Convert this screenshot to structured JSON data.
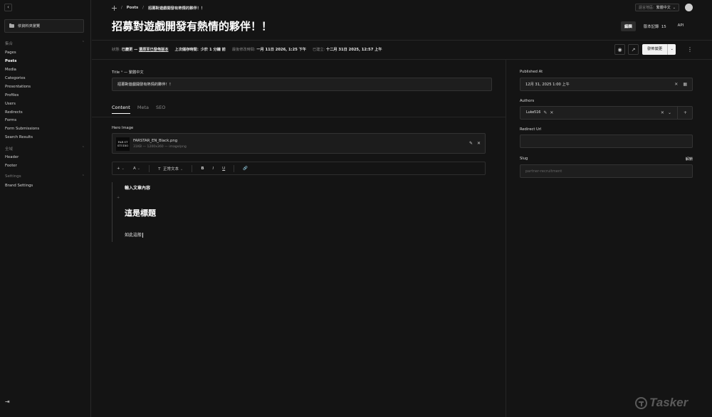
{
  "sidebar": {
    "back_icon": "‹",
    "folder_label": "依資料夾瀏覽",
    "groups": [
      {
        "label": "集合",
        "items": [
          {
            "label": "Pages",
            "active": false
          },
          {
            "label": "Posts",
            "active": true
          },
          {
            "label": "Media",
            "active": false
          },
          {
            "label": "Categories",
            "active": false
          },
          {
            "label": "Presentations",
            "active": false
          },
          {
            "label": "Profiles",
            "active": false
          },
          {
            "label": "Users",
            "active": false
          },
          {
            "label": "Redirects",
            "active": false
          },
          {
            "label": "Forms",
            "active": false
          },
          {
            "label": "Form Submissions",
            "active": false
          },
          {
            "label": "Search Results",
            "active": false
          }
        ]
      },
      {
        "label": "全域",
        "items": [
          {
            "label": "Header",
            "active": false
          },
          {
            "label": "Footer",
            "active": false
          }
        ]
      },
      {
        "label": "Settings",
        "items": [
          {
            "label": "Brand Settings",
            "active": false
          }
        ]
      }
    ],
    "logout_icon": "⇥"
  },
  "header": {
    "breadcrumb": {
      "section": "Posts",
      "current": "招募對遊戲開發有熱情的夥伴！！",
      "sep": "/"
    },
    "language": {
      "label": "語言地區:",
      "value": "繁體中文",
      "chevron": "⌄"
    },
    "title": "招募對遊戲開發有熱情的夥伴！！",
    "view_tabs": [
      {
        "label": "編輯",
        "active": true
      },
      {
        "label": "版本記錄",
        "count": "15",
        "active": false
      },
      {
        "label": "API",
        "active": false
      }
    ]
  },
  "status": {
    "status_label": "狀態:",
    "status_value": "已變更 —",
    "revert_link": "還原至已發佈版本",
    "autosave_label": "上次儲存時間：",
    "autosave_value": "少於 1 分鐘 前",
    "modified_label": "最後修改時間:",
    "modified_value": "一月 11日 2026, 1:25 下午",
    "created_label": "已建立:",
    "created_value": "十二月 31日 2025, 12:57 上午",
    "publish_label": "發佈變更",
    "publish_chevron": "⌄",
    "preview_icon": "◉",
    "open_icon": "↗",
    "more_icon": "⋮"
  },
  "form": {
    "title_label": "Title",
    "title_required": "*",
    "title_locale": "— 繁體中文",
    "title_value": "招募對遊戲開發有熱情的夥伴！！",
    "tabs": [
      {
        "label": "Content",
        "active": true
      },
      {
        "label": "Meta",
        "active": false
      },
      {
        "label": "SEO",
        "active": false
      }
    ],
    "hero_label": "Hero Image",
    "hero": {
      "thumb_line1": "FAR ST",
      "thumb_line2": "STUDIO",
      "filename": "FARSTAR_EN_Black.png",
      "meta": "31KB — 1200x360 — image/png",
      "edit_icon": "✎",
      "remove_icon": "✕"
    },
    "toolbar": {
      "insert": "+",
      "color": "A",
      "text_icon": "T",
      "block_type": "正常文本",
      "bold": "B",
      "italic": "I",
      "underline": "U",
      "link": "🔗",
      "caret": "⌄"
    },
    "editor": {
      "p1": "輸入文章內容",
      "plus": "+",
      "heading": "這是標題",
      "p2": "如此這般"
    }
  },
  "side": {
    "published_label": "Published At",
    "published_value": "12月 31, 2025 1:00 上午",
    "authors_label": "Authors",
    "author_chip": "Luke516",
    "redirect_label": "Redirect Url",
    "redirect_value": "",
    "slug_label": "Slug",
    "slug_unlock": "解鎖",
    "slug_value": "partner-recruitment",
    "clear_icon": "✕",
    "calendar_icon": "▦",
    "add_icon": "+",
    "chevron": "⌄",
    "chip_edit_icon": "✎"
  },
  "watermark": {
    "text": "Tasker"
  }
}
